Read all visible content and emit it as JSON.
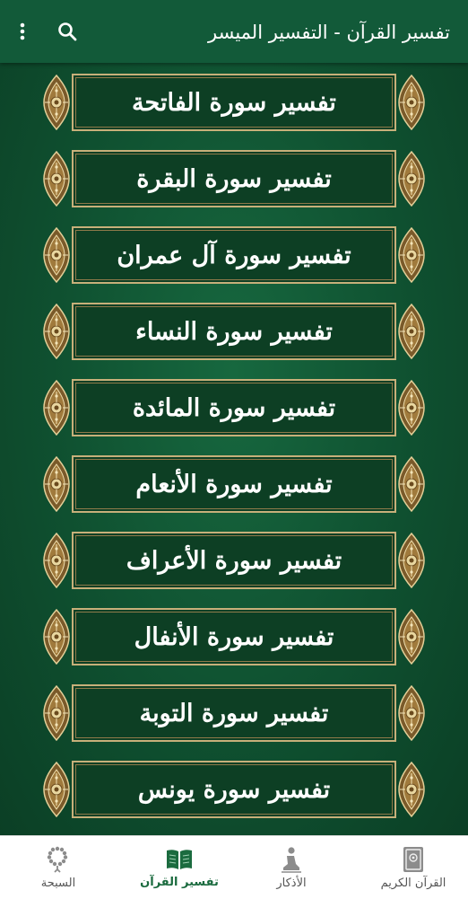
{
  "app_bar": {
    "title": "تفسير القرآن - التفسير الميسر",
    "search_icon": "search-icon",
    "menu_icon": "more-vertical-icon"
  },
  "surah_list": [
    {
      "label": "تفسير سورة الفاتحة"
    },
    {
      "label": "تفسير سورة البقرة"
    },
    {
      "label": "تفسير سورة آل عمران"
    },
    {
      "label": "تفسير سورة النساء"
    },
    {
      "label": "تفسير سورة المائدة"
    },
    {
      "label": "تفسير سورة الأنعام"
    },
    {
      "label": "تفسير سورة الأعراف"
    },
    {
      "label": "تفسير سورة الأنفال"
    },
    {
      "label": "تفسير سورة التوبة"
    },
    {
      "label": "تفسير سورة يونس"
    }
  ],
  "bottom_nav": [
    {
      "label": "القرآن الكريم",
      "icon": "quran-book-icon",
      "active": false
    },
    {
      "label": "الأذكار",
      "icon": "prayer-icon",
      "active": false
    },
    {
      "label": "تفسير القرآن",
      "icon": "open-book-icon",
      "active": true
    },
    {
      "label": "السبحة",
      "icon": "prayer-beads-icon",
      "active": false
    }
  ],
  "colors": {
    "app_bar": "#125a39",
    "background": "#0f4a2c",
    "plaque_border": "#c7b07a",
    "nav_active": "#1b6b3f"
  }
}
